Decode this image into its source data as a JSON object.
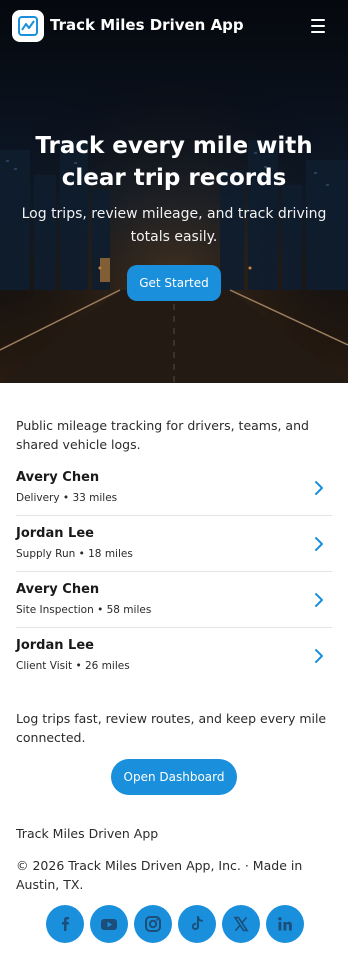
{
  "header": {
    "app_title": "Track Miles Driven App",
    "logo_icon": "mileage-chart-icon",
    "menu_icon": "hamburger-menu-icon"
  },
  "hero": {
    "heading": "Track every mile with clear trip records",
    "subheading": "Log trips, review mileage, and track driving totals easily.",
    "cta_label": "Get Started"
  },
  "intro": {
    "text": "Public mileage tracking for drivers, teams, and shared vehicle logs."
  },
  "trips": [
    {
      "name": "Avery Chen",
      "meta": "Delivery • 33 miles"
    },
    {
      "name": "Jordan Lee",
      "meta": "Supply Run • 18 miles"
    },
    {
      "name": "Avery Chen",
      "meta": "Site Inspection • 58 miles"
    },
    {
      "name": "Jordan Lee",
      "meta": "Client Visit • 26 miles"
    }
  ],
  "outro": {
    "text": "Log trips fast, review routes, and keep every mile connected.",
    "button_label": "Open Dashboard"
  },
  "footer": {
    "app_name": "Track Miles Driven App",
    "copyright": "© 2026 Track Miles Driven App, Inc. · Made in Austin, TX."
  },
  "socials": [
    "facebook-icon",
    "youtube-icon",
    "instagram-icon",
    "tiktok-icon",
    "x-icon",
    "linkedin-icon"
  ],
  "colors": {
    "accent": "#1a8fdc",
    "social_glyph": "#1b4f7a"
  }
}
